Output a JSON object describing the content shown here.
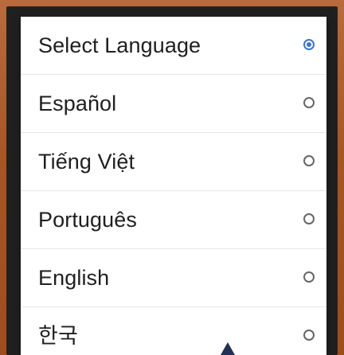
{
  "dialog": {
    "options": [
      {
        "label": "Select Language",
        "selected": true
      },
      {
        "label": "Español",
        "selected": false
      },
      {
        "label": "Tiếng Việt",
        "selected": false
      },
      {
        "label": "Português",
        "selected": false
      },
      {
        "label": "English",
        "selected": false
      },
      {
        "label": "한국",
        "selected": false
      }
    ]
  },
  "colors": {
    "frame": "#b75f2e",
    "dialog_background": "#ffffff",
    "radio_selected": "#3b73d6",
    "radio_unselected": "#666666",
    "cursor": "#233055"
  },
  "icons": {
    "cursor": "up-arrow-cursor-icon"
  }
}
